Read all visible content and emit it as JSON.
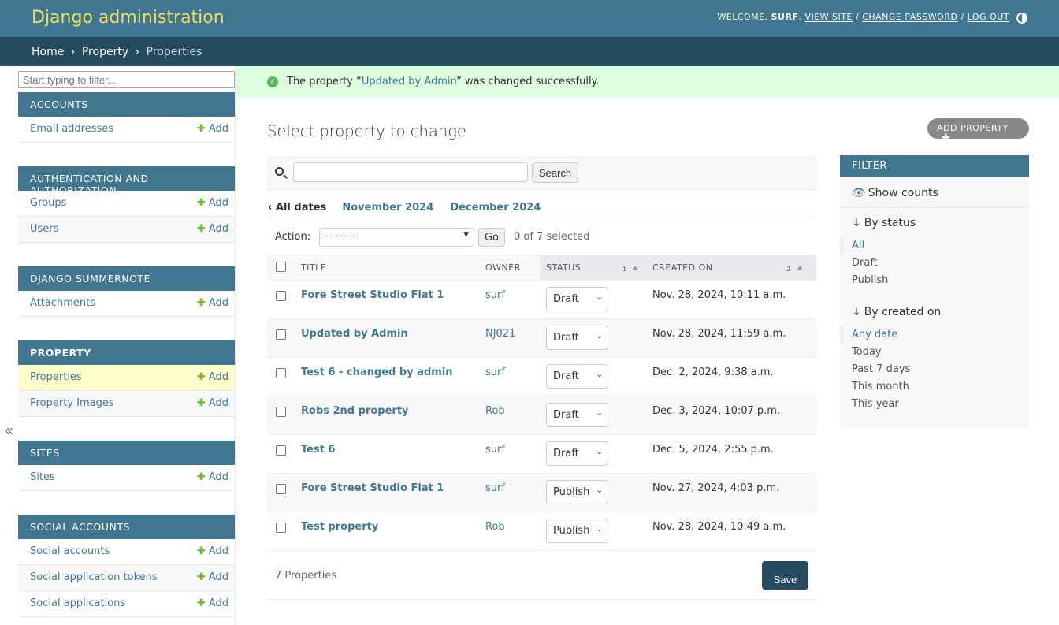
{
  "header": {
    "site_name": "Django administration",
    "welcome": "Welcome,",
    "username": "surf",
    "view_site": "View site",
    "change_password": "Change password",
    "log_out": "Log out",
    "sep1": "/",
    "sep2": "/"
  },
  "breadcrumbs": {
    "home": "Home",
    "app": "Property",
    "current": "Properties",
    "sep": "›"
  },
  "sidebar": {
    "filter_placeholder": "Start typing to filter...",
    "add_label": "Add",
    "plus": "✚",
    "collapse": "«",
    "modules": [
      {
        "caption": "Accounts",
        "models": [
          {
            "name": "Email addresses"
          }
        ]
      },
      {
        "caption": "Authentication and Authorization",
        "models": [
          {
            "name": "Groups"
          },
          {
            "name": "Users"
          }
        ]
      },
      {
        "caption": "Django Summernote",
        "models": [
          {
            "name": "Attachments"
          }
        ]
      },
      {
        "caption": "Property",
        "models": [
          {
            "name": "Properties"
          },
          {
            "name": "Property Images"
          }
        ]
      },
      {
        "caption": "Sites",
        "models": [
          {
            "name": "Sites"
          }
        ]
      },
      {
        "caption": "Social Accounts",
        "models": [
          {
            "name": "Social accounts"
          },
          {
            "name": "Social application tokens"
          },
          {
            "name": "Social applications"
          }
        ]
      }
    ]
  },
  "message": {
    "icon": "check-icon",
    "prefix": "The property “",
    "link": "Updated by Admin",
    "suffix": "” was changed successfully."
  },
  "content": {
    "title": "Select property to change",
    "add_button": "Add property",
    "add_plus": "✚",
    "search_button": "Search",
    "date_back": "‹ All dates",
    "dates": [
      "November 2024",
      "December 2024"
    ],
    "action_label": "Action:",
    "action_value": "---------",
    "go": "Go",
    "selected": "0 of 7 selected",
    "columns": {
      "title": "Title",
      "owner": "Owner",
      "status": "Status",
      "created": "Created on",
      "status_sort": "1",
      "created_sort": "2"
    },
    "rows": [
      {
        "title": "Fore Street Studio Flat 1",
        "owner": "surf",
        "status": "Draft",
        "created": "Nov. 28, 2024, 10:11 a.m."
      },
      {
        "title": "Updated by Admin",
        "owner": "NJ021",
        "status": "Draft",
        "created": "Nov. 28, 2024, 11:59 a.m."
      },
      {
        "title": "Test 6 - changed by admin",
        "owner": "surf",
        "status": "Draft",
        "created": "Dec. 2, 2024, 9:38 a.m."
      },
      {
        "title": "Robs 2nd property",
        "owner": "Rob",
        "status": "Draft",
        "created": "Dec. 3, 2024, 10:07 p.m."
      },
      {
        "title": "Test 6",
        "owner": "surf",
        "status": "Draft",
        "created": "Dec. 5, 2024, 2:55 p.m."
      },
      {
        "title": "Fore Street Studio Flat 1",
        "owner": "surf",
        "status": "Publish",
        "created": "Nov. 27, 2024, 4:03 p.m."
      },
      {
        "title": "Test property",
        "owner": "Rob",
        "status": "Publish",
        "created": "Nov. 28, 2024, 10:49 a.m."
      }
    ],
    "count": "7 Properties",
    "save": "Save"
  },
  "filter": {
    "title": "Filter",
    "show_counts": "Show counts",
    "by_status": "By status",
    "status_options": [
      "All",
      "Draft",
      "Publish"
    ],
    "by_created": "By created on",
    "created_options": [
      "Any date",
      "Today",
      "Past 7 days",
      "This month",
      "This year"
    ]
  }
}
